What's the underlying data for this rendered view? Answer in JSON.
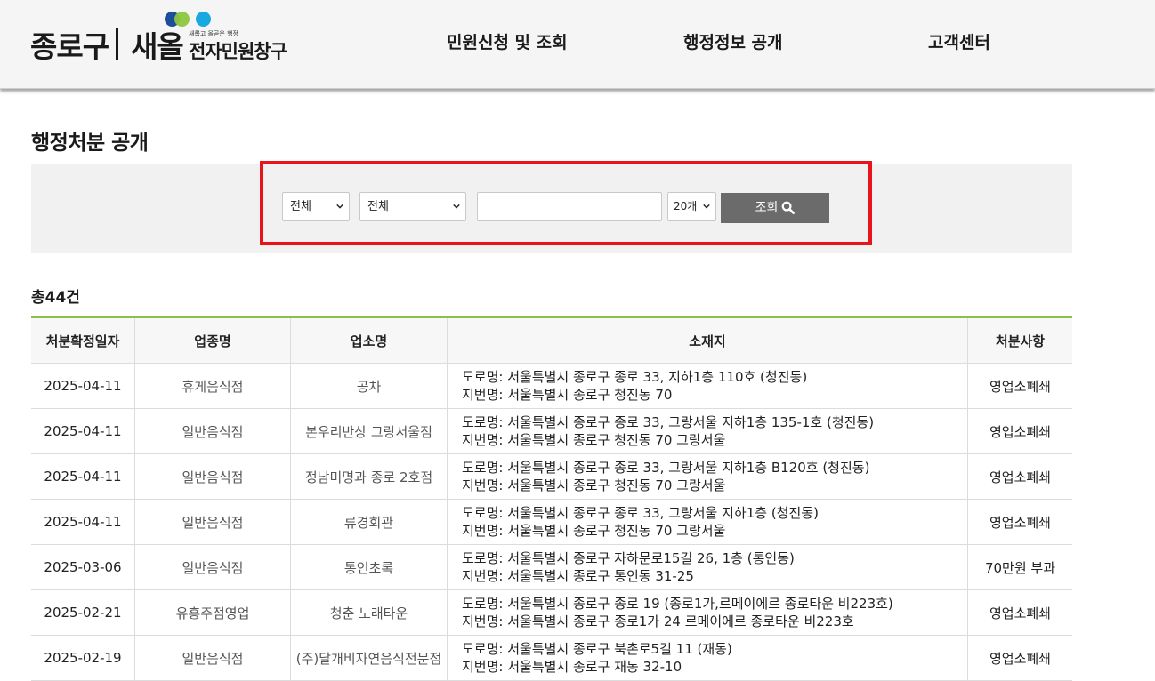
{
  "header": {
    "logo_main": "종로구",
    "logo_sae": "새올",
    "logo_slogan": "새롭고 올곧은 행정",
    "logo_sub": "전자민원창구",
    "nav": [
      {
        "label": "민원신청 및 조회"
      },
      {
        "label": "행정정보 공개"
      },
      {
        "label": "고객센터"
      }
    ]
  },
  "page_title": "행정처분 공개",
  "search": {
    "select1_value": "전체",
    "select2_value": "전체",
    "keyword_value": "",
    "page_size_value": "20개",
    "button_label": "조회"
  },
  "total_label": "총44건",
  "table": {
    "headers": [
      "처분확정일자",
      "업종명",
      "업소명",
      "소재지",
      "처분사항"
    ],
    "rows": [
      {
        "date": "2025-04-11",
        "type": "휴게음식점",
        "name": "공차",
        "road": "도로명: 서울특별시 종로구 종로 33, 지하1층 110호 (청진동)",
        "lot": "지번명: 서울특별시 종로구 청진동 70",
        "action": "영업소폐쇄"
      },
      {
        "date": "2025-04-11",
        "type": "일반음식점",
        "name": "본우리반상 그랑서울점",
        "road": "도로명: 서울특별시 종로구 종로 33, 그랑서울 지하1층 135-1호 (청진동)",
        "lot": "지번명: 서울특별시 종로구 청진동 70 그랑서울",
        "action": "영업소폐쇄"
      },
      {
        "date": "2025-04-11",
        "type": "일반음식점",
        "name": "정남미명과 종로 2호점",
        "road": "도로명: 서울특별시 종로구 종로 33, 그랑서울 지하1층 B120호 (청진동)",
        "lot": "지번명: 서울특별시 종로구 청진동 70 그랑서울",
        "action": "영업소폐쇄"
      },
      {
        "date": "2025-04-11",
        "type": "일반음식점",
        "name": "류경회관",
        "road": "도로명: 서울특별시 종로구 종로 33, 그랑서울 지하1층 (청진동)",
        "lot": "지번명: 서울특별시 종로구 청진동 70 그랑서울",
        "action": "영업소폐쇄"
      },
      {
        "date": "2025-03-06",
        "type": "일반음식점",
        "name": "통인초록",
        "road": "도로명: 서울특별시 종로구 자하문로15길 26, 1층 (통인동)",
        "lot": "지번명: 서울특별시 종로구 통인동 31-25",
        "action": "70만원 부과"
      },
      {
        "date": "2025-02-21",
        "type": "유흥주점영업",
        "name": "청춘 노래타운",
        "road": "도로명: 서울특별시 종로구 종로 19 (종로1가,르메이에르 종로타운 비223호)",
        "lot": "지번명: 서울특별시 종로구 종로1가 24 르메이에르 종로타운 비223호",
        "action": "영업소폐쇄"
      },
      {
        "date": "2025-02-19",
        "type": "일반음식점",
        "name": "(주)달개비자연음식전문점",
        "road": "도로명: 서울특별시 종로구 북촌로5길 11 (재동)",
        "lot": "지번명: 서울특별시 종로구 재동 32-10",
        "action": "영업소폐쇄"
      }
    ]
  }
}
